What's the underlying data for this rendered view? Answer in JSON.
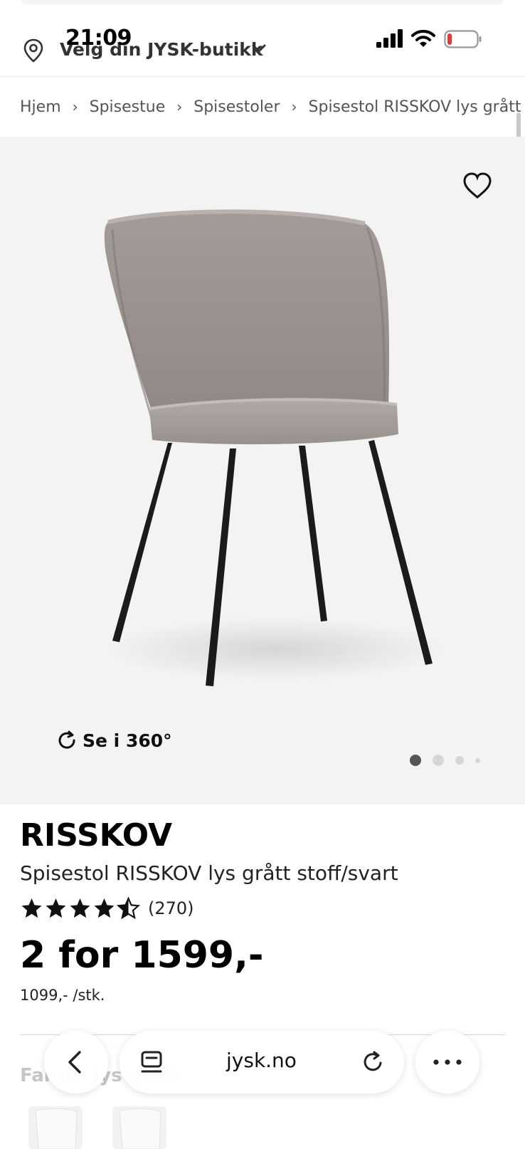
{
  "status_bar": {
    "time": "21:09"
  },
  "store_selector": {
    "label": "Velg din JYSK-butikk"
  },
  "breadcrumb": [
    "Hjem",
    "Spisestue",
    "Spisestoler",
    "Spisestol RISSKOV lys grått stoff/svart"
  ],
  "gallery": {
    "view360_label": "Se i 360°",
    "slide_count": 4,
    "active_slide": 1
  },
  "product": {
    "brand": "RISSKOV",
    "name": "Spisestol RISSKOV lys grått stoff/svart",
    "rating": 4.5,
    "rating_max": 5,
    "review_count": "(270)",
    "price": "2 for 1599,-",
    "unit_price": "1099,- /stk."
  },
  "color_section": {
    "label": "Farge: lys grått"
  },
  "browser": {
    "url": "jysk.no"
  },
  "colors": {
    "accent": "#111111",
    "image_bg": "#f3f3f3",
    "muted": "#555555"
  }
}
